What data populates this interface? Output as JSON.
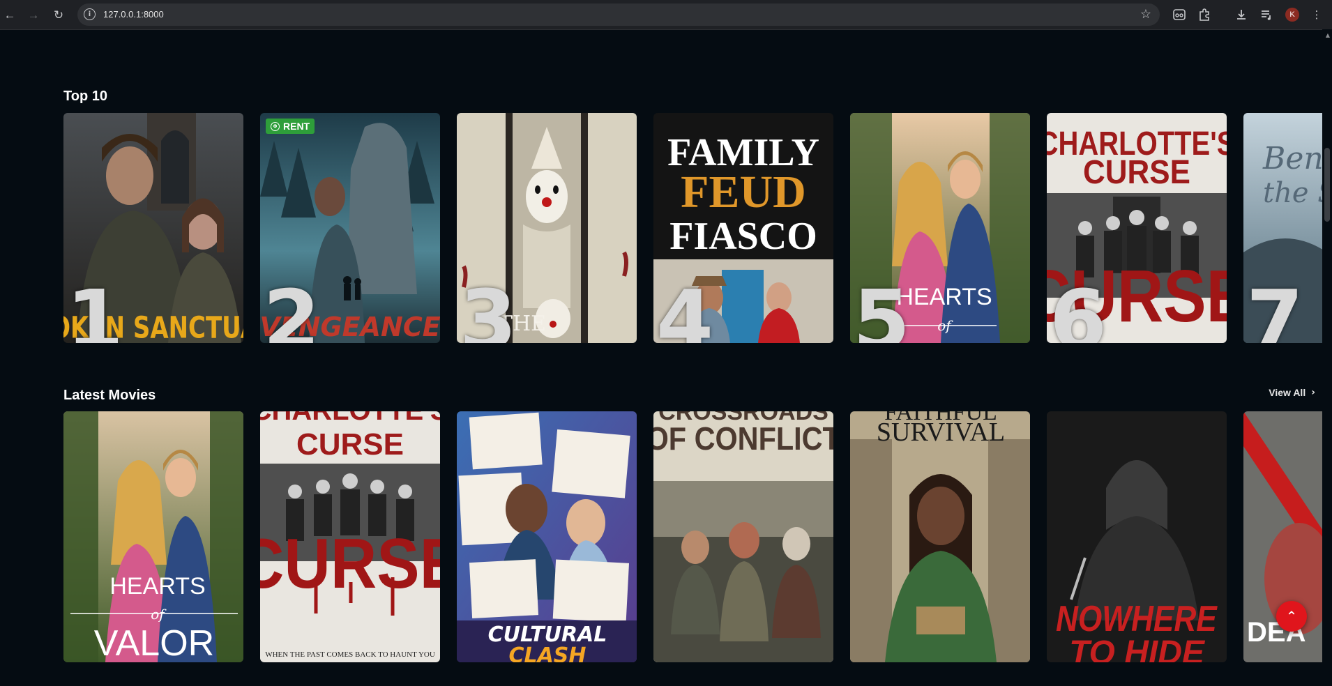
{
  "browser": {
    "url": "127.0.0.1:8000",
    "profile_initial": "K"
  },
  "sections": {
    "top10_title": "Top 10",
    "latest_title": "Latest Movies",
    "view_all": "View All"
  },
  "top10": [
    {
      "rank": "1",
      "title_text": "BROKEN SANCTUARY"
    },
    {
      "rank": "2",
      "title_text": "VENGEANCE",
      "badge": "RENT"
    },
    {
      "rank": "3",
      "title_text": "THE"
    },
    {
      "rank": "4",
      "title_line1": "FAMILY",
      "title_line2": "FEUD",
      "title_line3": "FIASCO"
    },
    {
      "rank": "5",
      "title_line1": "HEARTS",
      "title_line2": "of"
    },
    {
      "rank": "6",
      "title_line1": "CHARLOTTE'S",
      "title_line2": "CURSE",
      "title_line3": "CURSE"
    },
    {
      "rank": "7",
      "title_line1": "Ben",
      "title_line2": "the S"
    }
  ],
  "latest": [
    {
      "title_line1": "HEARTS",
      "title_line2": "of",
      "title_line3": "VALOR"
    },
    {
      "title_line1": "CHARLOTTE'S",
      "title_line2": "CURSE",
      "title_line3": "CURSE",
      "tagline": "WHEN THE PAST COMES BACK TO HAUNT YOU"
    },
    {
      "title_line1": "CULTURAL",
      "title_line2": "CLASH"
    },
    {
      "title_line1": "CROSSROADS",
      "title_line2": "OF CONFLICT"
    },
    {
      "title_line1": "FAITHFUL",
      "title_line2": "SURVIVAL"
    },
    {
      "title_line1": "NOWHERE",
      "title_line2": "TO HIDE"
    },
    {
      "title_line1": "DEA"
    }
  ]
}
